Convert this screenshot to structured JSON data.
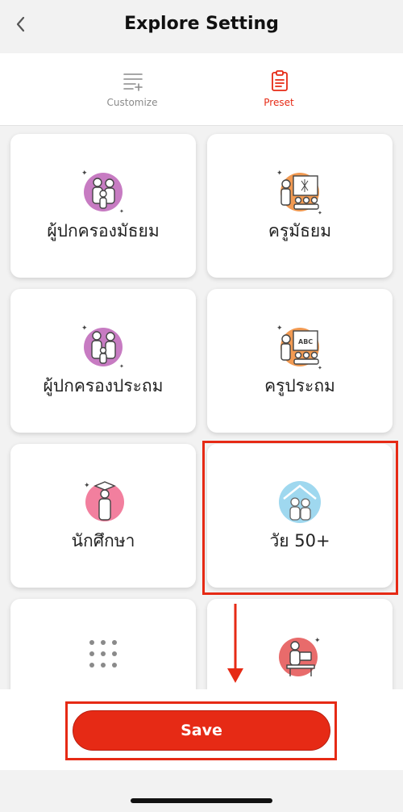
{
  "header": {
    "title": "Explore Setting",
    "back_icon": "chevron-left-icon"
  },
  "tabs": [
    {
      "label": "Customize",
      "icon": "list-add-icon",
      "selected": false
    },
    {
      "label": "Preset",
      "icon": "clipboard-icon",
      "selected": true
    }
  ],
  "presets": [
    {
      "label": "ผู้ปกครองมัธยม",
      "icon": "family-icon"
    },
    {
      "label": "ครูมัธยม",
      "icon": "teacher-icon"
    },
    {
      "label": "ผู้ปกครองประถม",
      "icon": "family-icon"
    },
    {
      "label": "ครูประถม",
      "icon": "teacher-abc-icon"
    },
    {
      "label": "นักศึกษา",
      "icon": "graduate-icon"
    },
    {
      "label": "วัย 50+",
      "icon": "elderly-couple-icon"
    },
    {
      "label": "",
      "icon": "grid-dots-icon"
    },
    {
      "label": "",
      "icon": "office-worker-icon"
    }
  ],
  "footer": {
    "save_label": "Save"
  },
  "colors": {
    "accent": "#e62a15",
    "tab_inactive": "#8a8a8a",
    "family_circle": "#c77bc2",
    "teacher_circle": "#f29a52",
    "student_circle": "#f27f9e",
    "elderly_circle": "#9fd8ef",
    "worker_circle": "#e86b6b"
  }
}
